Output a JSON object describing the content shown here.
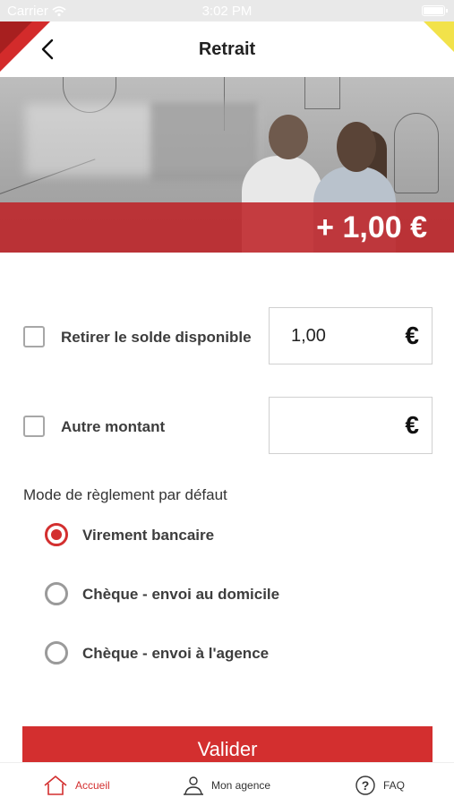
{
  "status_bar": {
    "carrier": "Carrier",
    "time": "3:02 PM"
  },
  "header": {
    "title": "Retrait"
  },
  "banner": {
    "amount": "+ 1,00 €"
  },
  "form": {
    "withdraw_balance": {
      "label": "Retirer le solde disponible",
      "value": "1,00",
      "currency": "€",
      "checked": false
    },
    "other_amount": {
      "label": "Autre montant",
      "value": "",
      "currency": "€",
      "checked": false
    }
  },
  "payment": {
    "title": "Mode de règlement par défaut",
    "options": [
      {
        "label": "Virement bancaire",
        "selected": true
      },
      {
        "label": "Chèque - envoi au domicile",
        "selected": false
      },
      {
        "label": "Chèque - envoi à l'agence",
        "selected": false
      }
    ]
  },
  "submit_label": "Valider",
  "nav": {
    "items": [
      {
        "label": "Accueil",
        "icon": "home-icon",
        "active": true
      },
      {
        "label": "Mon agence",
        "icon": "person-icon",
        "active": false
      },
      {
        "label": "FAQ",
        "icon": "question-icon",
        "active": false
      }
    ]
  },
  "colors": {
    "accent": "#d32f2f",
    "corner_yellow": "#f2e24a"
  }
}
